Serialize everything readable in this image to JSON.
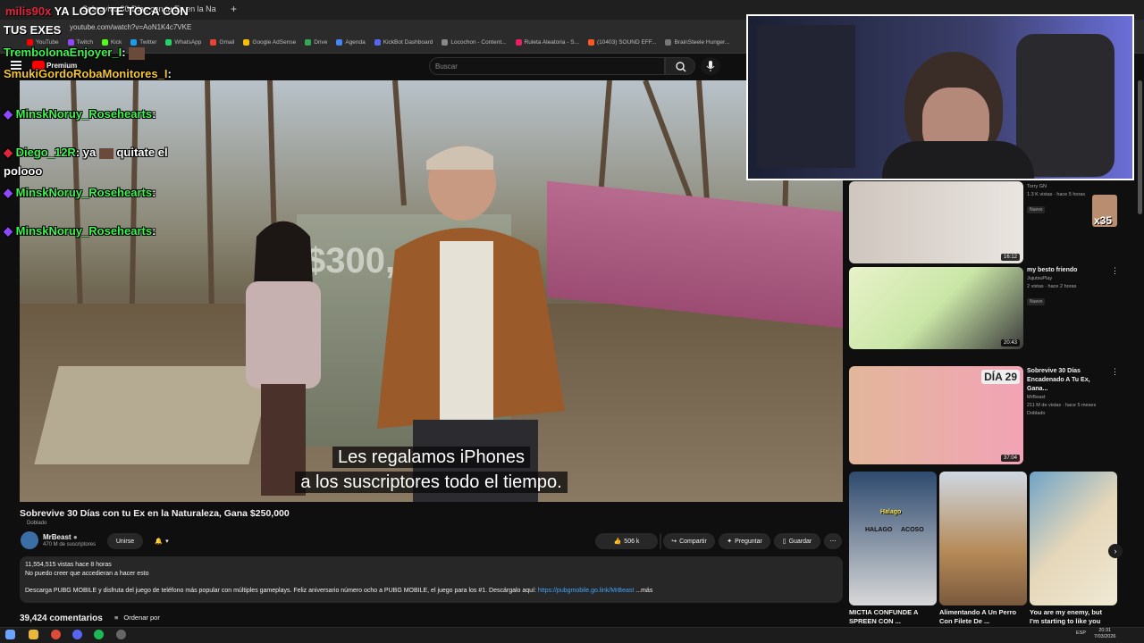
{
  "browser": {
    "tab_title": "Sobrevive 30 Días con tu Ex en la Naturaleza...",
    "url": "youtube.com/watch?v=AoN1K4c7VKE",
    "bookmarks": [
      "YouTube",
      "Twitch",
      "Kick",
      "Twitter",
      "WhatsApp",
      "Gmail",
      "Google AdSense",
      "Drive",
      "Agenda",
      "KickBot Dashboard",
      "Locochon - Content...",
      "Ruleta Aleatoria - S...",
      "(10403) SOUND EFF...",
      "BrainSteele Hunger..."
    ]
  },
  "youtube": {
    "logo": "Premium",
    "search_placeholder": "Buscar"
  },
  "overlay": {
    "alert_name": "milis90x",
    "alert_text": "YA LOCO TE TOCA CON",
    "alert_text2": "TUS EXES"
  },
  "chat": [
    {
      "user": "TrembolonaEnjoyer_I",
      "text": ":"
    },
    {
      "user": "SmukiGordoRobaMonitores_I",
      "text": ":"
    },
    {
      "user": "MinskNoruy_Rosehearts",
      "text": ":"
    },
    {
      "user": "Diego_12R",
      "text": ": ya",
      "extra": "quitate el polooo"
    },
    {
      "user": "MinskNoruy_Rosehearts",
      "text": ":"
    },
    {
      "user": "MinskNoruy_Rosehearts",
      "text": ":"
    }
  ],
  "video": {
    "money_overlay": "$300,0",
    "subtitle_line1": "Les regalamos iPhones",
    "subtitle_line2": "a los suscriptores todo el tiempo.",
    "title": "Sobrevive 30 Días con tu Ex en la Naturaleza, Gana $250,000",
    "dubbed": "Doblado",
    "channel": "MrBeast",
    "subscribers": "470 M de suscriptores",
    "join": "Unirse",
    "likes": "506 k",
    "share": "Compartir",
    "ask": "Preguntar",
    "save": "Guardar",
    "stats": "11,554,515 vistas  hace 8 horas",
    "desc1": "No puedo creer que accedieran a hacer esto",
    "desc2": "Descarga PUBG MOBILE y disfruta del juego de teléfono más popular con múltiples gameplays. Feliz aniversario número ocho a PUBG MOBILE, el juego para los #1. Descárgalo aquí:",
    "desc_link": "https://pubgmobile.go.link/MrBeast",
    "desc_more": "...más",
    "comments": "39,424 comentarios",
    "sort": "Ordenar por"
  },
  "related": [
    {
      "title": "",
      "channel": "Torry GN",
      "meta": "1.3 K vistas · hace 5 horas",
      "badge": "Nuevo",
      "duration": "16:12"
    },
    {
      "title": "my besto friendo",
      "channel": "JujutsuPlay",
      "meta": "2 vistas · hace 2 horas",
      "badge": "Nuevo",
      "duration": "20:43"
    },
    {
      "title": "Sobrevive 30 Días Encadenado A Tu Ex, Gana...",
      "channel": "MrBeast",
      "meta": "211 M de vistas · hace 5 meses",
      "badge": "Doblado",
      "duration": "37:04",
      "thumb_text": "DÍA 29"
    }
  ],
  "shorts": [
    {
      "title": "MICTIA CONFUNDE A SPREEN CON ...",
      "labels": [
        "Halago",
        "HALAGO",
        "ACOSO"
      ]
    },
    {
      "title": "Alimentando A Un Perro Con Filete De ..."
    },
    {
      "title": "You are my enemy, but I'm starting to like you"
    }
  ],
  "webcam_badge": "x35",
  "clock": {
    "time": "20:31",
    "date": "7/03/2026",
    "lang": "ESP"
  },
  "colors": {
    "chat_green": "#3ff24f",
    "chat_yellow": "#f2c531",
    "alert_red": "#e0243a",
    "link": "#3ea6ff"
  }
}
